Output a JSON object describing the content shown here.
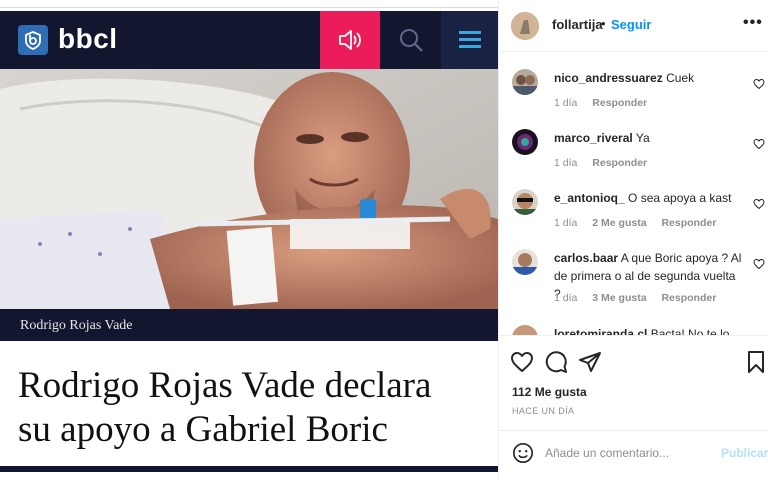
{
  "media": {
    "site_name": "bbcl",
    "caption": "Rodrigo Rojas Vade",
    "headline_line1": "Rodrigo Rojas Vade declara",
    "headline_line2": "su apoyo a Gabriel Boric",
    "brand_color": "#12162e",
    "accent_color": "#ec1c5a",
    "icons": [
      "bbcl-logo-icon",
      "speaker-icon",
      "search-icon",
      "menu-icon"
    ]
  },
  "post": {
    "username": "follartija",
    "separator": "•",
    "follow_label": "Seguir",
    "more_label": "•••"
  },
  "comments": [
    {
      "user": "nico_andressuarez",
      "text": "Cuek",
      "time": "1 día",
      "likes": "",
      "reply": "Responder"
    },
    {
      "user": "marco_riveral",
      "text": "Ya",
      "time": "1 día",
      "likes": "",
      "reply": "Responder"
    },
    {
      "user": "e_antonioq_",
      "text": "O sea apoya a kast",
      "time": "1 día",
      "likes": "2 Me gusta",
      "reply": "Responder"
    },
    {
      "user": "carlos.baar",
      "text": "A que Boric apoya ? Al de primera o al de segunda vuelta ?",
      "time": "1 día",
      "likes": "3 Me gusta",
      "reply": "Responder"
    },
    {
      "user": "loretomiranda.cl",
      "text": "Bacta! No te lo",
      "time": "",
      "likes": "",
      "reply": ""
    }
  ],
  "actions": {
    "likes_count": "112 Me gusta",
    "time_ago": "HACE UN DÍA",
    "icons": [
      "heart-icon",
      "comment-icon",
      "share-icon",
      "bookmark-icon"
    ]
  },
  "add_comment": {
    "placeholder": "Añade un comentario...",
    "publish_label": "Publicar",
    "publish_color": "#b2dffc"
  }
}
